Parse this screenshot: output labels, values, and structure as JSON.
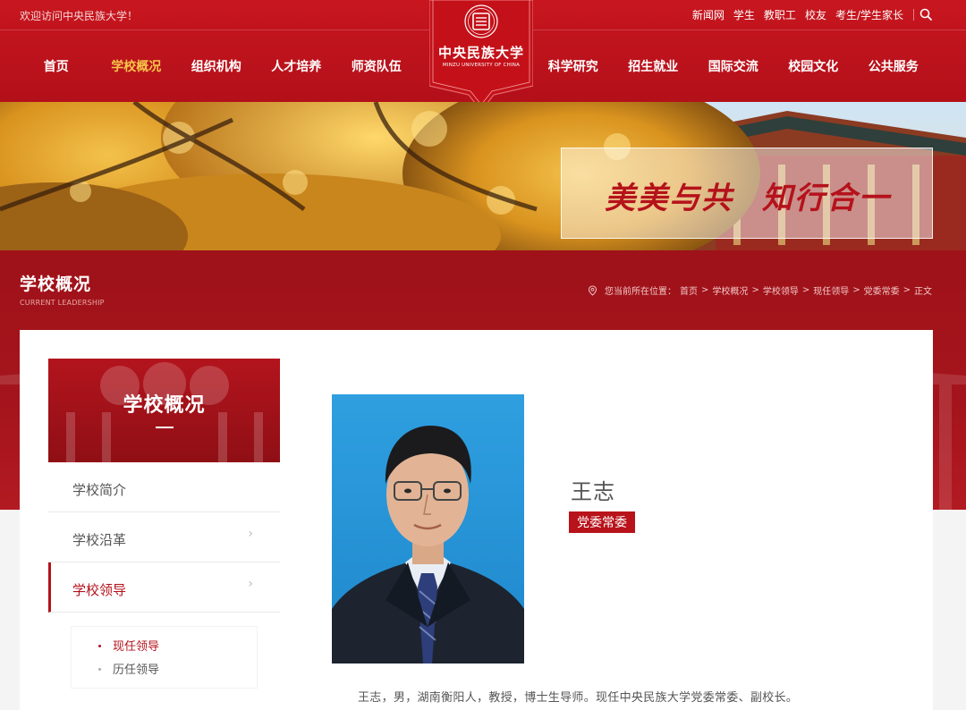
{
  "header": {
    "welcome": "欢迎访问中央民族大学！",
    "top_links": [
      "新闻网",
      "学生",
      "教职工",
      "校友",
      "考生/学生家长"
    ],
    "nav_left": [
      "首页",
      "学校概况",
      "组织机构",
      "人才培养",
      "师资队伍"
    ],
    "nav_right": [
      "科学研究",
      "招生就业",
      "国际交流",
      "校园文化",
      "公共服务"
    ],
    "active_nav": "学校概况",
    "logo_cn": "中央民族大学",
    "logo_en": "MINZU UNIVERSITY OF CHINA"
  },
  "banner": {
    "slogan": "美美与共 知行合一"
  },
  "section": {
    "title": "学校概况",
    "subtitle": "CURRENT LEADERSHIP",
    "breadcrumb_prefix": "您当前所在位置：",
    "breadcrumb": [
      "首页",
      "学校概况",
      "学校领导",
      "现任领导",
      "党委常委",
      "正文"
    ]
  },
  "sidebar": {
    "title": "学校概况",
    "items": [
      {
        "label": "学校简介",
        "arrow": false
      },
      {
        "label": "学校沿革",
        "arrow": true
      },
      {
        "label": "学校领导",
        "arrow": true
      }
    ],
    "sub_items": [
      "现任领导",
      "历任领导"
    ]
  },
  "profile": {
    "name": "王志",
    "title": "党委常委",
    "bio": "王志，男，湖南衡阳人，教授，博士生导师。现任中央民族大学党委常委、副校长。"
  },
  "colors": {
    "brand_red": "#c8161f",
    "accent_gold": "#f7c64a",
    "title_badge": "#b8121b"
  }
}
